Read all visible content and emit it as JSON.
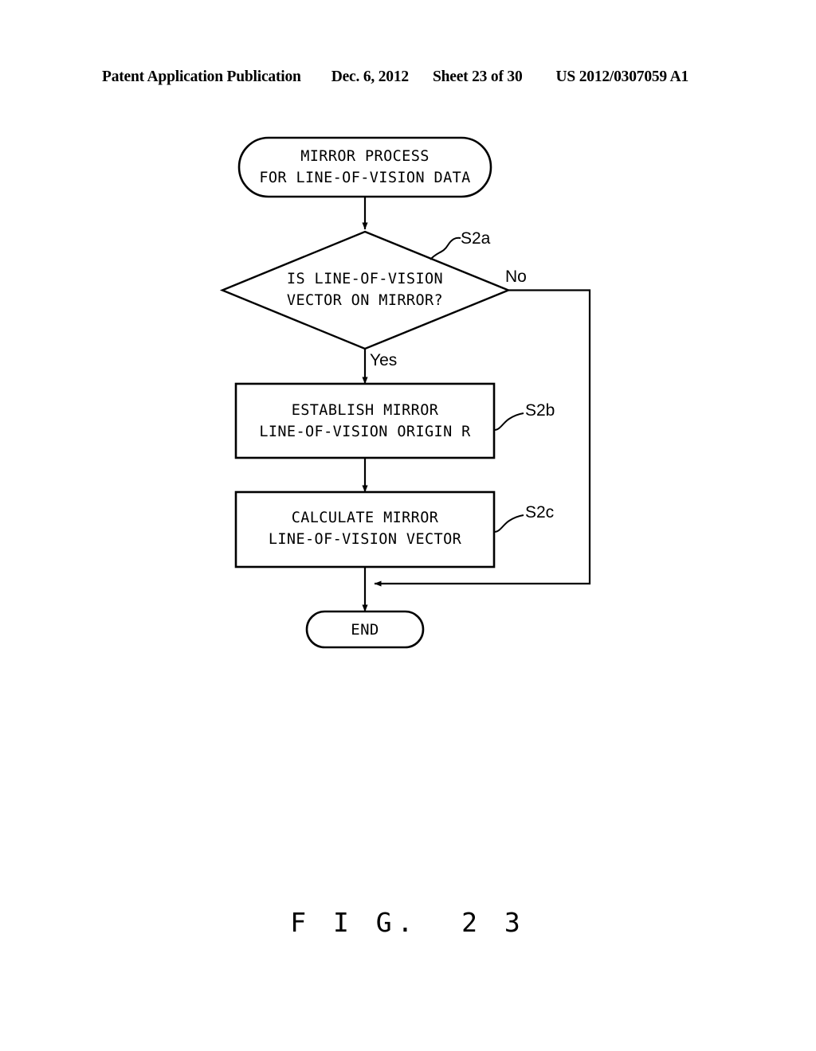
{
  "header": {
    "publication": "Patent Application Publication",
    "date": "Dec. 6, 2012",
    "sheet": "Sheet 23 of 30",
    "patent_number": "US 2012/0307059 A1"
  },
  "figure": {
    "caption": "F I G.  2 3",
    "nodes": {
      "start": "MIRROR PROCESS\nFOR LINE-OF-VISION DATA",
      "decision": "IS LINE-OF-VISION\nVECTOR ON MIRROR?",
      "process_1": "ESTABLISH MIRROR\nLINE-OF-VISION ORIGIN R",
      "process_2": "CALCULATE MIRROR\nLINE-OF-VISION VECTOR",
      "end": "END"
    },
    "reference_labels": {
      "decision": "S2a",
      "process_1": "S2b",
      "process_2": "S2c"
    },
    "branch_labels": {
      "no": "No",
      "yes": "Yes"
    }
  },
  "colors": {
    "ink": "#000000",
    "paper": "#ffffff"
  }
}
